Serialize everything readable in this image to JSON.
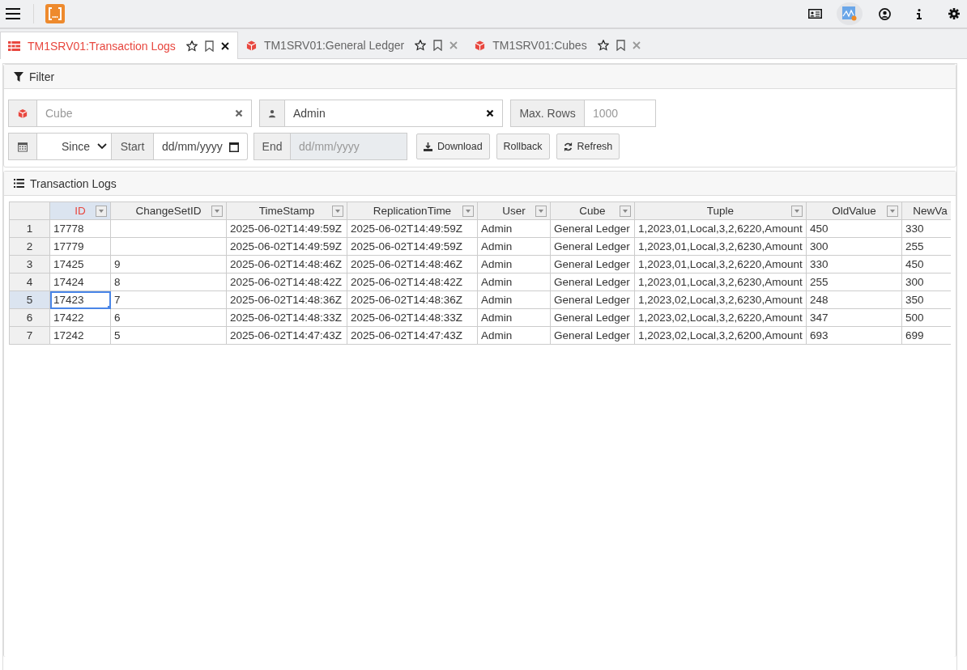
{
  "tabs": [
    {
      "label": "TM1SRV01:Transaction Logs",
      "kind": "log",
      "selected": true
    },
    {
      "label": "TM1SRV01:General Ledger",
      "kind": "cube",
      "selected": false
    },
    {
      "label": "TM1SRV01:Cubes",
      "kind": "cube",
      "selected": false
    }
  ],
  "filter": {
    "title": "Filter",
    "cube_field": {
      "placeholder": "Cube"
    },
    "user_field": {
      "value": "Admin"
    },
    "max_rows": {
      "label": "Max. Rows",
      "placeholder": "1000"
    },
    "since_select": {
      "value": "Since"
    },
    "start": {
      "label": "Start",
      "placeholder": "dd/mm/yyyy"
    },
    "end": {
      "label": "End",
      "placeholder": "dd/mm/yyyy",
      "disabled": true
    },
    "buttons": [
      {
        "label": "Download",
        "kind": "download"
      },
      {
        "label": "Rollback",
        "kind": "plain"
      },
      {
        "label": "Refresh",
        "kind": "refresh"
      }
    ]
  },
  "logs": {
    "title": "Transaction Logs",
    "columns": [
      {
        "label": "ID",
        "filter": true,
        "selected": true
      },
      {
        "label": "ChangeSetID",
        "filter": true,
        "selected": false
      },
      {
        "label": "TimeStamp",
        "filter": true,
        "selected": false
      },
      {
        "label": "ReplicationTime",
        "filter": true,
        "selected": false
      },
      {
        "label": "User",
        "filter": true,
        "selected": false
      },
      {
        "label": "Cube",
        "filter": true,
        "selected": false
      },
      {
        "label": "Tuple",
        "filter": true,
        "selected": false
      },
      {
        "label": "OldValue",
        "filter": true,
        "selected": false
      },
      {
        "label": "NewVa",
        "filter": false,
        "selected": false
      }
    ],
    "rows": [
      {
        "number": "1",
        "selected": false,
        "cells": [
          "17778",
          "",
          "2025-06-02T14:49:59Z",
          "2025-06-02T14:49:59Z",
          "Admin",
          "General Ledger",
          "1,2023,01,Local,3,2,6220,Amount",
          "450",
          "330"
        ]
      },
      {
        "number": "2",
        "selected": false,
        "cells": [
          "17779",
          "",
          "2025-06-02T14:49:59Z",
          "2025-06-02T14:49:59Z",
          "Admin",
          "General Ledger",
          "1,2023,01,Local,3,2,6230,Amount",
          "300",
          "255"
        ]
      },
      {
        "number": "3",
        "selected": false,
        "cells": [
          "17425",
          "9",
          "2025-06-02T14:48:46Z",
          "2025-06-02T14:48:46Z",
          "Admin",
          "General Ledger",
          "1,2023,01,Local,3,2,6220,Amount",
          "330",
          "450"
        ]
      },
      {
        "number": "4",
        "selected": false,
        "cells": [
          "17424",
          "8",
          "2025-06-02T14:48:42Z",
          "2025-06-02T14:48:42Z",
          "Admin",
          "General Ledger",
          "1,2023,01,Local,3,2,6230,Amount",
          "255",
          "300"
        ]
      },
      {
        "number": "5",
        "selected": true,
        "cells": [
          "17423",
          "7",
          "2025-06-02T14:48:36Z",
          "2025-06-02T14:48:36Z",
          "Admin",
          "General Ledger",
          "1,2023,02,Local,3,2,6230,Amount",
          "248",
          "350"
        ]
      },
      {
        "number": "6",
        "selected": false,
        "cells": [
          "17422",
          "6",
          "2025-06-02T14:48:33Z",
          "2025-06-02T14:48:33Z",
          "Admin",
          "General Ledger",
          "1,2023,02,Local,3,2,6220,Amount",
          "347",
          "500"
        ]
      },
      {
        "number": "7",
        "selected": false,
        "cells": [
          "17242",
          "5",
          "2025-06-02T14:47:43Z",
          "2025-06-02T14:47:43Z",
          "Admin",
          "General Ledger",
          "1,2023,02,Local,3,2,6200,Amount",
          "693",
          "699"
        ]
      }
    ]
  }
}
